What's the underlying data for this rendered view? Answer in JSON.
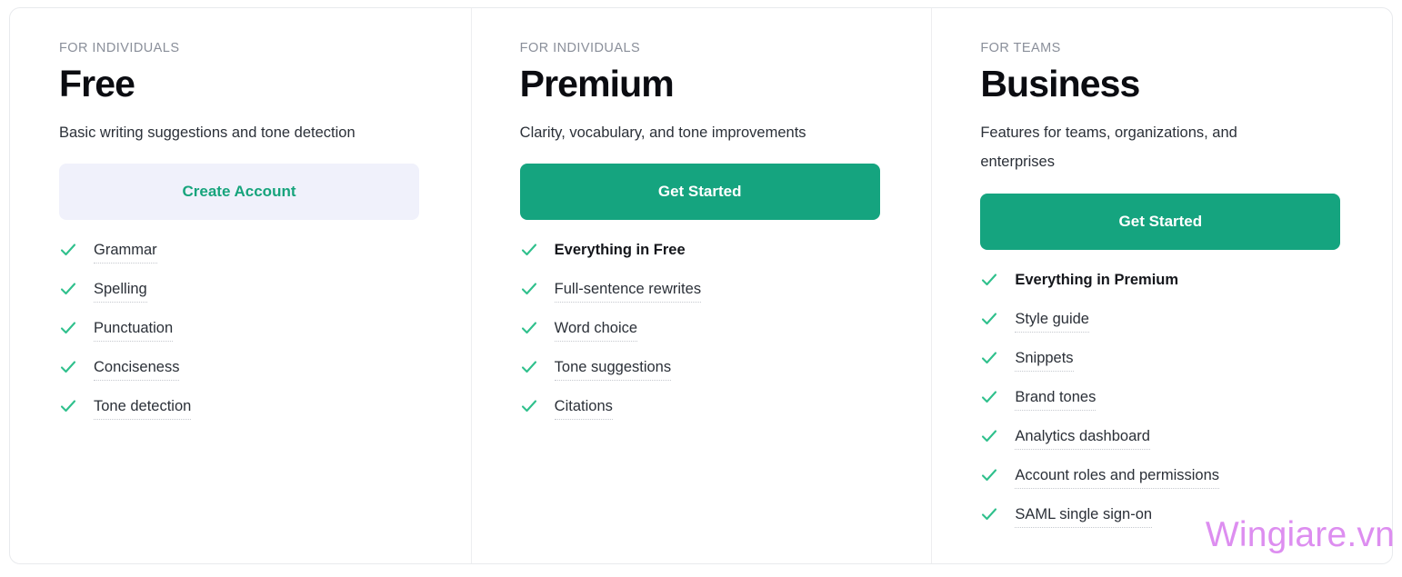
{
  "theme": {
    "primary_green": "#15a47f",
    "secondary_bg": "#f0f1fb",
    "secondary_text": "#17a47c",
    "check_color": "#2fc08c",
    "watermark_color": "#dd8ef0"
  },
  "plans": [
    {
      "eyebrow": "FOR INDIVIDUALS",
      "title": "Free",
      "description": "Basic writing suggestions and tone detection",
      "cta_label": "Create Account",
      "cta_style": "secondary",
      "features": [
        {
          "label": "Grammar",
          "bold": false
        },
        {
          "label": "Spelling",
          "bold": false
        },
        {
          "label": "Punctuation",
          "bold": false
        },
        {
          "label": "Conciseness",
          "bold": false
        },
        {
          "label": "Tone detection",
          "bold": false
        }
      ]
    },
    {
      "eyebrow": "FOR INDIVIDUALS",
      "title": "Premium",
      "description": "Clarity, vocabulary, and tone improvements",
      "cta_label": "Get Started",
      "cta_style": "primary",
      "features": [
        {
          "label": "Everything in Free",
          "bold": true
        },
        {
          "label": "Full-sentence rewrites",
          "bold": false
        },
        {
          "label": "Word choice",
          "bold": false
        },
        {
          "label": "Tone suggestions",
          "bold": false
        },
        {
          "label": "Citations",
          "bold": false
        }
      ]
    },
    {
      "eyebrow": "FOR TEAMS",
      "title": "Business",
      "description": "Features for teams, organizations, and enterprises",
      "cta_label": "Get Started",
      "cta_style": "primary",
      "features": [
        {
          "label": "Everything in Premium",
          "bold": true
        },
        {
          "label": "Style guide",
          "bold": false
        },
        {
          "label": "Snippets",
          "bold": false
        },
        {
          "label": "Brand tones",
          "bold": false
        },
        {
          "label": "Analytics dashboard",
          "bold": false
        },
        {
          "label": "Account roles and permissions",
          "bold": false
        },
        {
          "label": "SAML single sign-on",
          "bold": false
        }
      ]
    }
  ],
  "watermark": {
    "text": "Wingiare.vn"
  }
}
